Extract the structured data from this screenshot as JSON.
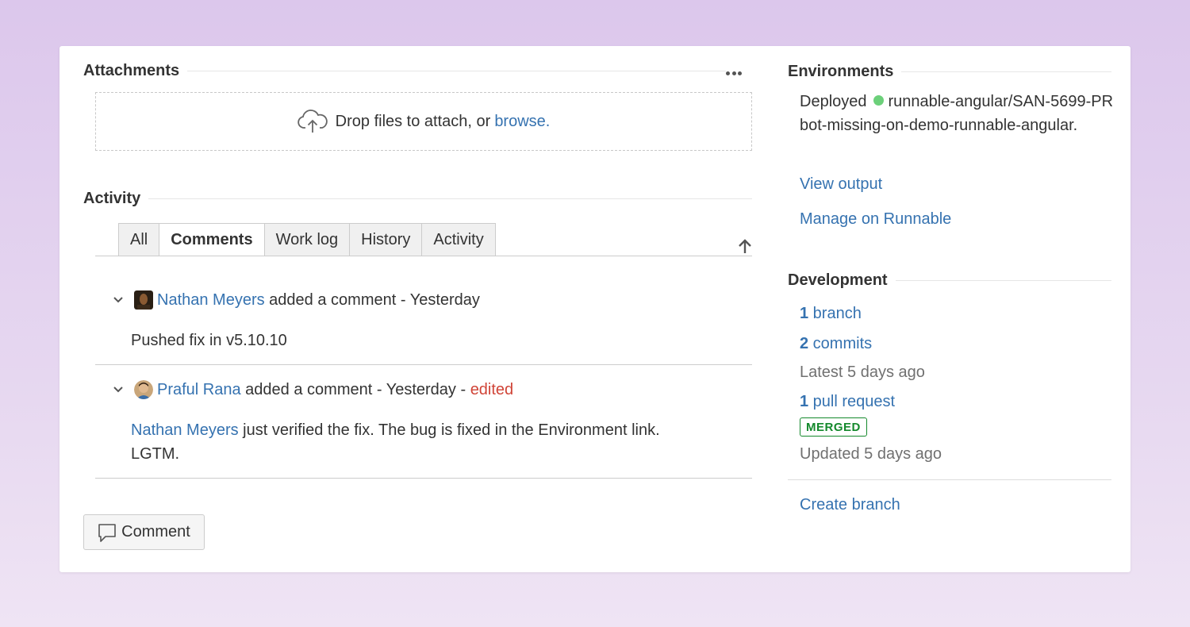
{
  "attachments": {
    "title": "Attachments",
    "drop_text": "Drop files to attach, or ",
    "browse_label": "browse."
  },
  "activity": {
    "title": "Activity",
    "tabs": [
      "All",
      "Comments",
      "Work log",
      "History",
      "Activity"
    ],
    "active_tab": "Comments"
  },
  "comments": [
    {
      "author": "Nathan Meyers",
      "action": " added a comment - Yesterday",
      "edited": "",
      "body_mention": "",
      "body": "Pushed fix in v5.10.10"
    },
    {
      "author": "Praful Rana",
      "action": " added a comment - Yesterday - ",
      "edited": "edited",
      "body_mention": "Nathan Meyers",
      "body": " just verified the fix. The bug is fixed in the Environment link. LGTM."
    }
  ],
  "comment_button": "Comment",
  "environments": {
    "title": "Environments",
    "deployed_label": "Deployed",
    "deploy_name": "runnable-angular/SAN-5699-PRbot-missing-on-demo-runnable-angular.",
    "view_output": "View output",
    "manage": "Manage on Runnable",
    "status_color": "#6cd07a"
  },
  "development": {
    "title": "Development",
    "branch_count": "1",
    "branch_label": " branch",
    "commits_count": "2",
    "commits_label": " commits",
    "latest": "Latest 5 days ago",
    "pr_count": "1",
    "pr_label": " pull request",
    "pr_status": "MERGED",
    "updated": "Updated 5 days ago",
    "create_branch": "Create branch"
  }
}
